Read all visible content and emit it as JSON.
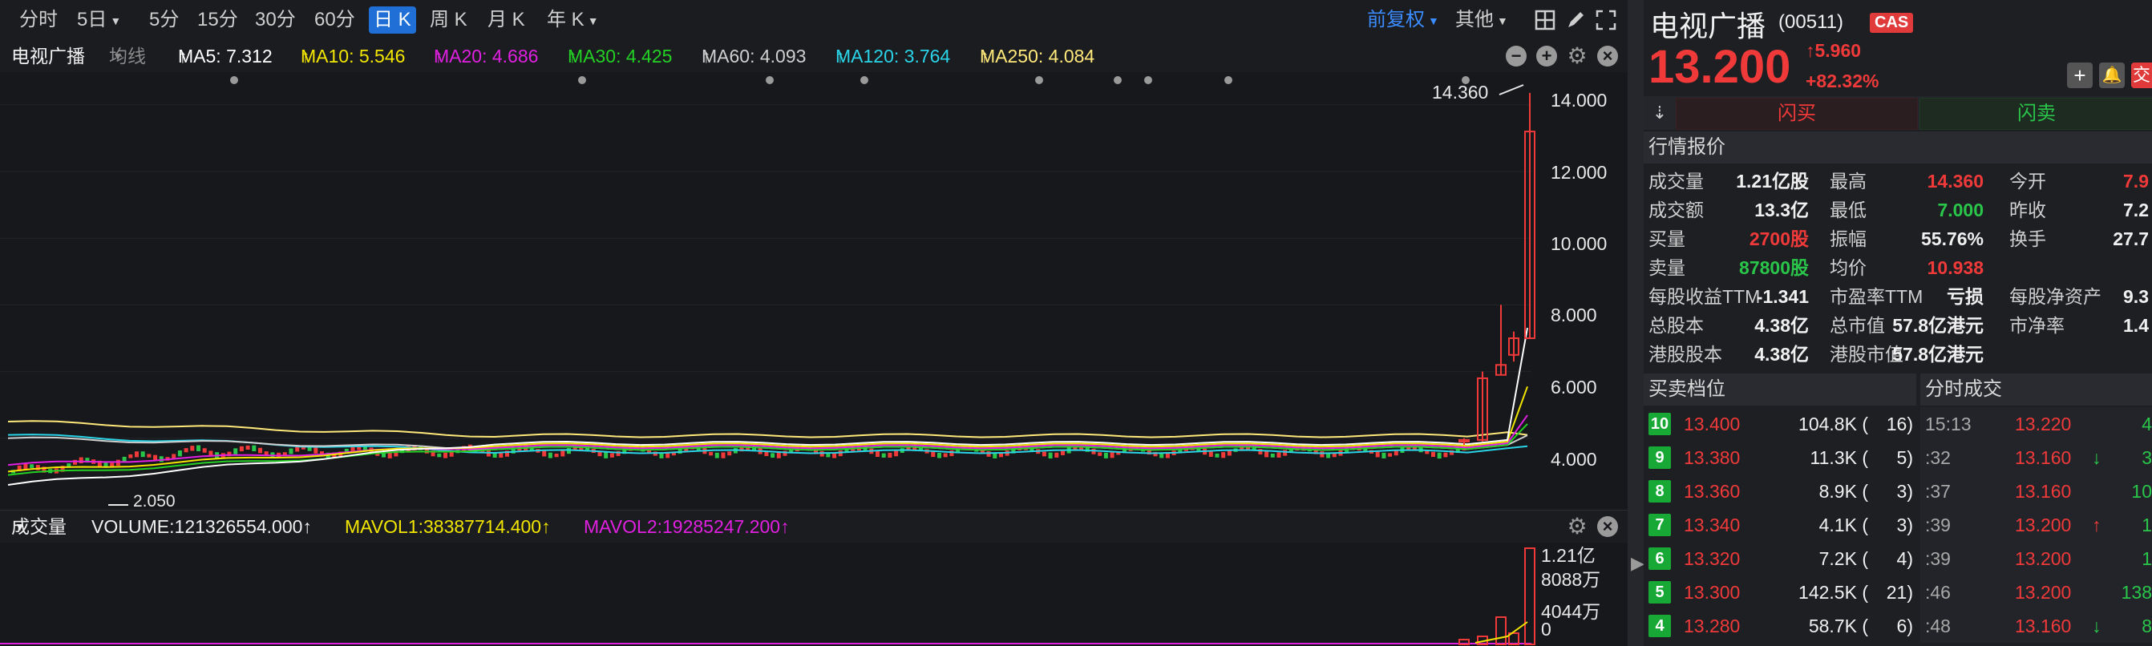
{
  "toolbar": {
    "periods": [
      "分时",
      "5日",
      "5分",
      "15分",
      "30分",
      "60分",
      "日 K",
      "周 K",
      "月 K",
      "年 K"
    ],
    "active_period": "日 K",
    "adjust_label": "前复权",
    "other_label": "其他"
  },
  "ma_bar": {
    "stock_name": "电视广播",
    "line_type": "均线",
    "ma5": "MA5: 7.312",
    "ma10": "MA10: 5.546",
    "ma20": "MA20: 4.686",
    "ma30": "MA30: 4.425",
    "ma60": "MA60: 4.093",
    "ma120": "MA120: 3.764",
    "ma250": "MA250: 4.084",
    "arrow": "↑",
    "colors": {
      "ma5": "#ffffff",
      "ma10": "#f2e600",
      "ma20": "#e020e0",
      "ma30": "#23d023",
      "ma60": "#cfcfcf",
      "ma120": "#2ad4e8",
      "ma250": "#ffe97a"
    }
  },
  "price_axis": [
    "14.000",
    "12.000",
    "10.000",
    "8.000",
    "6.000",
    "4.000"
  ],
  "price_high_label": "14.360",
  "price_low_label": "2.050",
  "volume_bar": {
    "title": "成交量",
    "volume": "VOLUME:121326554.000↑",
    "mavol1": "MAVOL1:38387714.400↑",
    "mavol2": "MAVOL2:19285247.200↑"
  },
  "volume_axis": [
    "1.21亿",
    "8088万",
    "4044万",
    "0"
  ],
  "header": {
    "name": "电视广播",
    "code": "(00511)",
    "badge": "CAS",
    "price": "13.200",
    "change": "5.960",
    "change_pct": "+82.32%"
  },
  "trade_buttons": {
    "buy": "闪买",
    "sell": "闪卖",
    "trade_stub": "交"
  },
  "quote": {
    "title": "行情报价",
    "rows": [
      [
        {
          "l": "成交量",
          "v": "1.21亿股",
          "c": "white"
        },
        {
          "l": "最高",
          "v": "14.360",
          "c": "red"
        },
        {
          "l": "今开",
          "v": "7.9",
          "c": "red"
        }
      ],
      [
        {
          "l": "成交额",
          "v": "13.3亿",
          "c": "white"
        },
        {
          "l": "最低",
          "v": "7.000",
          "c": "green"
        },
        {
          "l": "昨收",
          "v": "7.2",
          "c": "white"
        }
      ],
      [
        {
          "l": "买量",
          "v": "2700股",
          "c": "red"
        },
        {
          "l": "振幅",
          "v": "55.76%",
          "c": "white"
        },
        {
          "l": "换手",
          "v": "27.7",
          "c": "white"
        }
      ],
      [
        {
          "l": "卖量",
          "v": "87800股",
          "c": "green"
        },
        {
          "l": "均价",
          "v": "10.938",
          "c": "red"
        },
        {
          "l": "",
          "v": "",
          "c": "white"
        }
      ],
      [
        {
          "l": "每股收益TTM",
          "v": "-1.341",
          "c": "white"
        },
        {
          "l": "市盈率TTM",
          "v": "亏损",
          "c": "white"
        },
        {
          "l": "每股净资产",
          "v": "9.3",
          "c": "white"
        }
      ],
      [
        {
          "l": "总股本",
          "v": "4.38亿",
          "c": "white"
        },
        {
          "l": "总市值",
          "v": "57.8亿港元",
          "c": "white"
        },
        {
          "l": "市净率",
          "v": "1.4",
          "c": "white"
        }
      ],
      [
        {
          "l": "港股股本",
          "v": "4.38亿",
          "c": "white"
        },
        {
          "l": "港股市值",
          "v": "57.8亿港元",
          "c": "white"
        },
        {
          "l": "",
          "v": "",
          "c": "white"
        }
      ]
    ]
  },
  "orderbook": {
    "title": "买卖档位",
    "rows": [
      {
        "lvl": "10",
        "price": "13.400",
        "vol": "104.8K (",
        "cnt": "16)"
      },
      {
        "lvl": "9",
        "price": "13.380",
        "vol": "11.3K (",
        "cnt": "5)"
      },
      {
        "lvl": "8",
        "price": "13.360",
        "vol": "8.9K (",
        "cnt": "3)"
      },
      {
        "lvl": "7",
        "price": "13.340",
        "vol": "4.1K (",
        "cnt": "3)"
      },
      {
        "lvl": "6",
        "price": "13.320",
        "vol": "7.2K (",
        "cnt": "4)"
      },
      {
        "lvl": "5",
        "price": "13.300",
        "vol": "142.5K (",
        "cnt": "21)"
      },
      {
        "lvl": "4",
        "price": "13.280",
        "vol": "58.7K (",
        "cnt": "6)"
      }
    ]
  },
  "trades": {
    "title": "分时成交",
    "rows": [
      {
        "time": "15:13",
        "price": "13.220",
        "arrow": "",
        "vol": "4"
      },
      {
        "time": ":32",
        "price": "13.160",
        "arrow": "↓",
        "vol": "3"
      },
      {
        "time": ":37",
        "price": "13.160",
        "arrow": "",
        "vol": "10"
      },
      {
        "time": ":39",
        "price": "13.200",
        "arrow": "↑",
        "vol": "1"
      },
      {
        "time": ":39",
        "price": "13.200",
        "arrow": "",
        "vol": "1"
      },
      {
        "time": ":46",
        "price": "13.200",
        "arrow": "",
        "vol": "138"
      },
      {
        "time": ":48",
        "price": "13.160",
        "arrow": "↓",
        "vol": "8"
      }
    ]
  },
  "chart_data": {
    "type": "candlestick",
    "ylim": [
      2.0,
      14.5
    ],
    "y_ticks": [
      4,
      6,
      8,
      10,
      12,
      14
    ],
    "last_days": [
      {
        "o": 3.9,
        "h": 4.0,
        "l": 3.8,
        "c": 3.95
      },
      {
        "o": 3.95,
        "h": 6.0,
        "l": 3.9,
        "c": 5.8
      },
      {
        "o": 5.9,
        "h": 8.0,
        "l": 5.9,
        "c": 6.2
      },
      {
        "o": 6.5,
        "h": 7.2,
        "l": 6.3,
        "c": 7.0
      },
      {
        "o": 7.0,
        "h": 14.36,
        "l": 7.0,
        "c": 13.2
      }
    ],
    "volume_ylim": [
      0,
      121326554
    ]
  }
}
